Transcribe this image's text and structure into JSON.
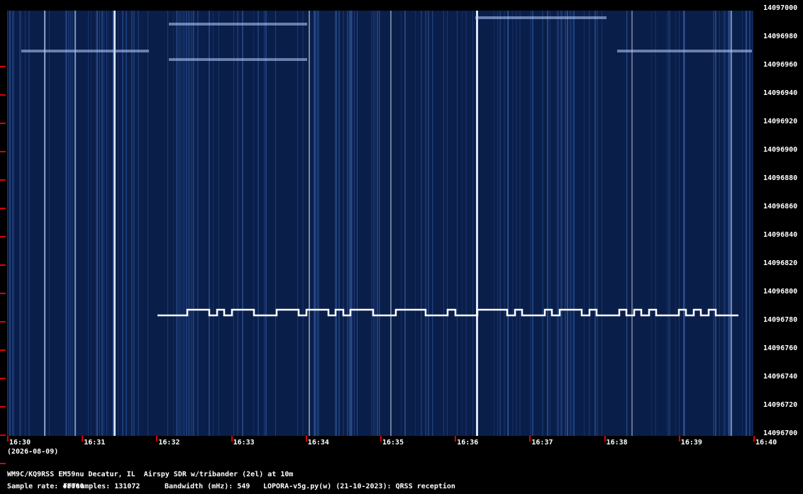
{
  "freq_axis": {
    "labels": [
      "14097000",
      "14096980",
      "14096960",
      "14096940",
      "14096920",
      "14096900",
      "14096880",
      "14096860",
      "14096840",
      "14096820",
      "14096800",
      "14096780",
      "14096760",
      "14096740",
      "14096720",
      "14096700"
    ]
  },
  "time_axis": {
    "labels": [
      "16:30",
      "16:31",
      "16:32",
      "16:33",
      "16:34",
      "16:35",
      "16:36",
      "16:37",
      "16:38",
      "16:39",
      "16:40"
    ],
    "date": "(2026-08-09)"
  },
  "footer": {
    "station": "WM9C/KQ9RSS EM59nu Decatur, IL  Airspy SDR w/tribander (2el) at 10m",
    "sample_rate": "Sample rate: 48000",
    "fft_samples": "FFTsamples: 131072",
    "bandwidth": "Bandwidth (mHz): 549",
    "software": "LOPORA-v5g.py(w) (21-10-2023): QRSS reception"
  },
  "colors": {
    "background": "#000000",
    "waterfall": "#0a1e4a",
    "tick": "#e00000",
    "text": "#ffffff",
    "signal": "#ffffff"
  },
  "waterfall": {
    "signal_freq": 14096780,
    "signal_start_time": "16:32",
    "signal_end_time": "16:40"
  }
}
